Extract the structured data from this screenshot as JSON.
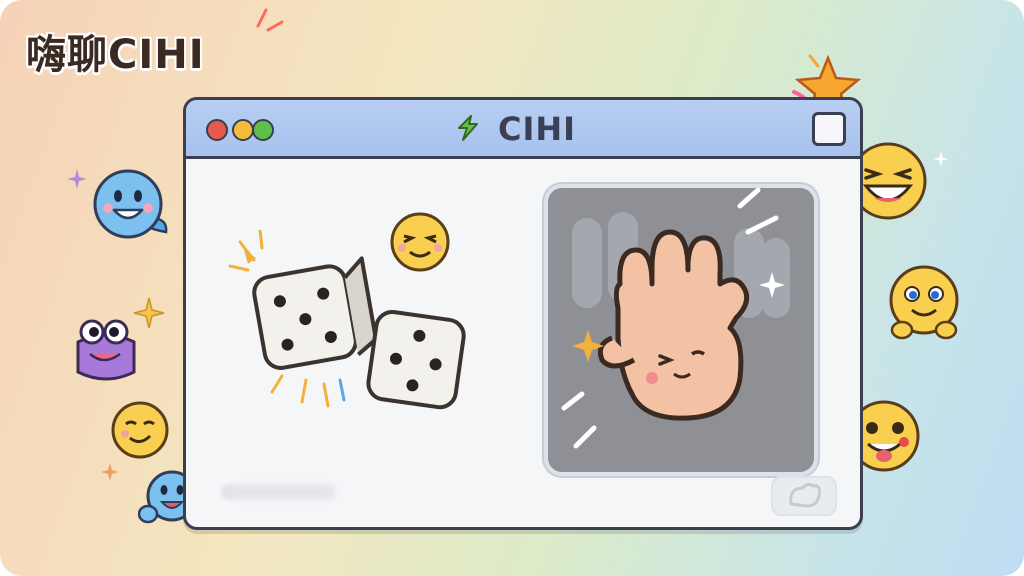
{
  "brand": {
    "text": "嗨聊CIHI"
  },
  "window": {
    "title": "CIHI",
    "traffic_lights": [
      "#e65a4e",
      "#f2bd3c",
      "#5fbf4a"
    ],
    "title_icon": "leaf-icon",
    "corner_icon": "square-icon"
  },
  "content": {
    "dice_icon": "dice-icon",
    "hand_icon": "waving-hand-icon",
    "send_icon": "send-icon"
  },
  "emojis": [
    "blue-smile-emoji",
    "purple-blob-emoji",
    "wink-emoji",
    "blue-wave-emoji",
    "laugh-emoji",
    "grin-emoji",
    "tongue-emoji",
    "star-emoji",
    "smile-emoji"
  ]
}
